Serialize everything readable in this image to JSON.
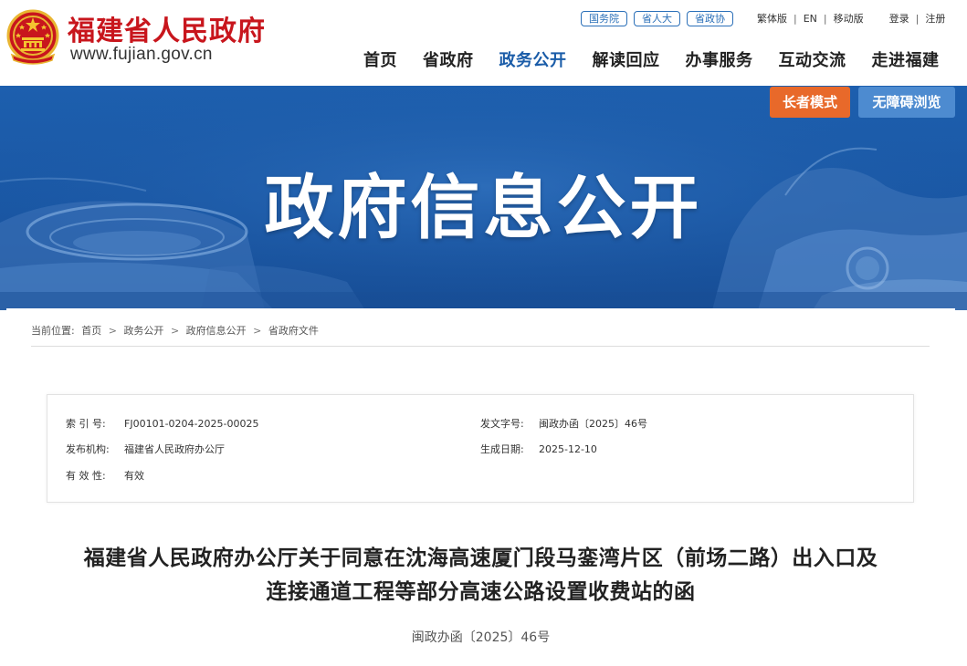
{
  "header": {
    "site_name": "福建省人民政府",
    "site_url": "www.fujian.gov.cn",
    "links": {
      "guowuyuan": "国务院",
      "shengrenda": "省人大",
      "shengzhengxie": "省政协",
      "traditional": "繁体版",
      "english": "EN",
      "mobile": "移动版",
      "login": "登录",
      "register": "注册"
    },
    "nav": [
      "首页",
      "省政府",
      "政务公开",
      "解读回应",
      "办事服务",
      "互动交流",
      "走进福建"
    ],
    "nav_active": "政务公开"
  },
  "banner": {
    "title": "政府信息公开",
    "elder_mode": "长者模式",
    "accessible": "无障碍浏览"
  },
  "breadcrumb": {
    "prefix": "当前位置:",
    "items": [
      "首页",
      "政务公开",
      "政府信息公开",
      "省政府文件"
    ]
  },
  "meta": {
    "index_label": "索 引 号:",
    "index_value": "FJ00101-0204-2025-00025",
    "docno_label": "发文字号:",
    "docno_value": "闽政办函〔2025〕46号",
    "org_label": "发布机构:",
    "org_value": "福建省人民政府办公厅",
    "date_label": "生成日期:",
    "date_value": "2025-12-10",
    "validity_label": "有 效 性:",
    "validity_value": "有效"
  },
  "document": {
    "title_line1": "福建省人民政府办公厅关于同意在沈海高速厦门段马銮湾片区（前场二路）出入口及",
    "title_line2": "连接通道工程等部分高速公路设置收费站的函",
    "number": "闽政办函〔2025〕46号"
  },
  "colors": {
    "brand_red": "#c8161d",
    "nav_active": "#1a5ca8",
    "banner_blue": "#1a57a4",
    "elder_orange": "#e8692a",
    "access_blue": "#4d8bd0"
  },
  "icons": {
    "emblem": "national-emblem-icon"
  }
}
